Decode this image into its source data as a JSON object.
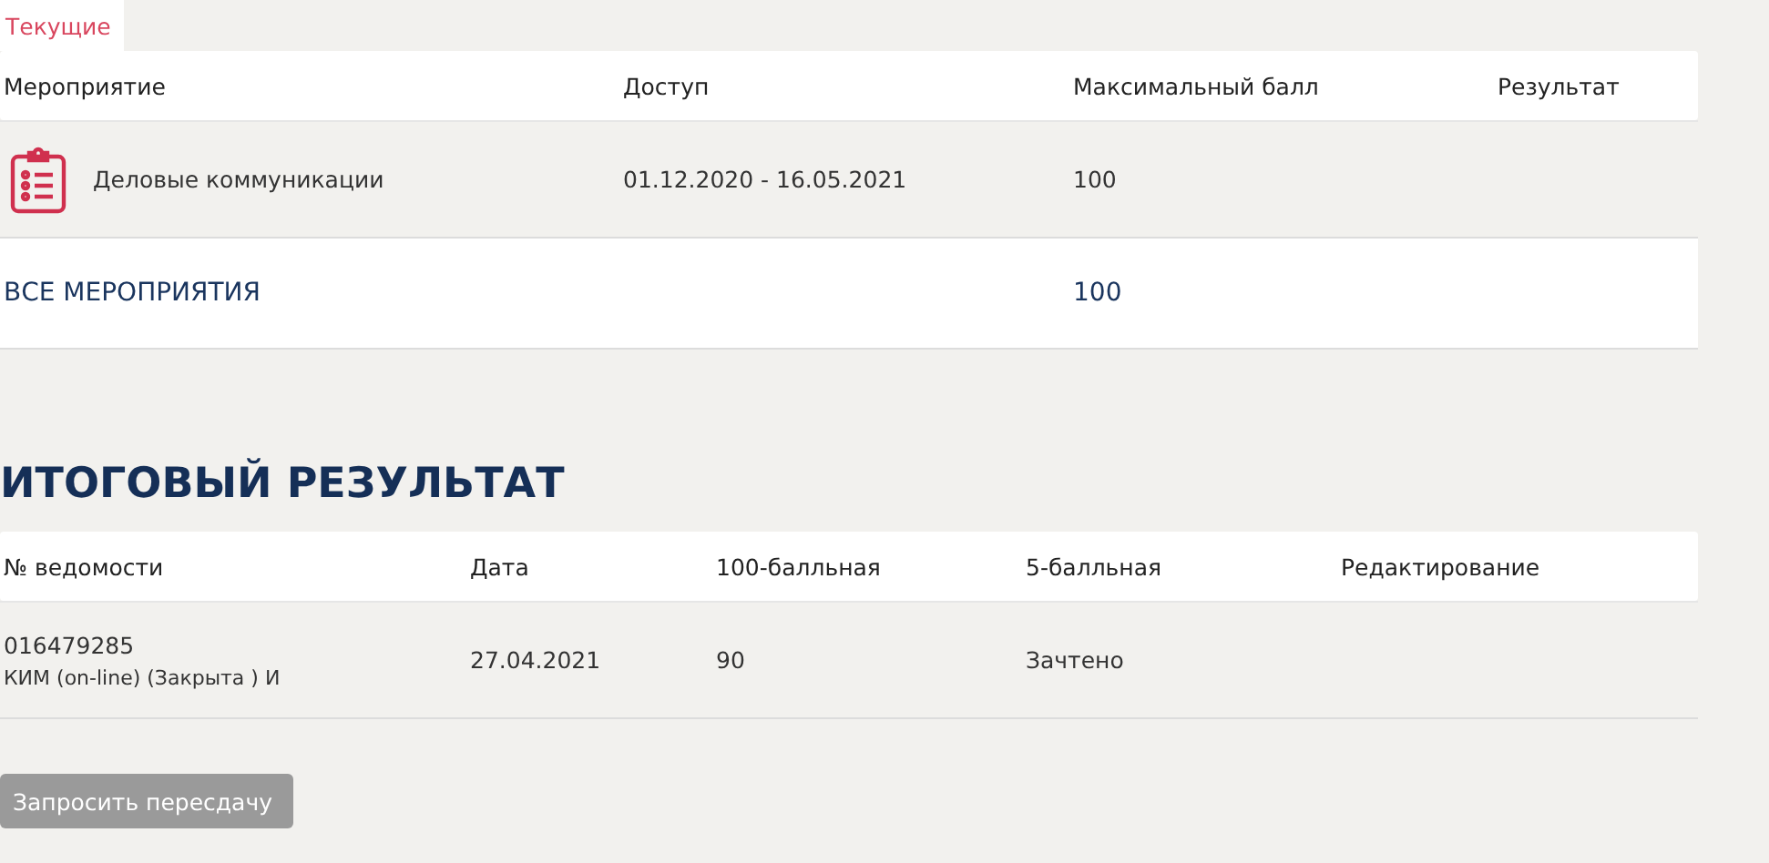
{
  "tabs": [
    {
      "label": "Текущие",
      "selected": true
    }
  ],
  "events_table": {
    "columns": [
      "Мероприятие",
      "Доступ",
      "Максимальный балл",
      "Результат"
    ],
    "rows": [
      {
        "name": "Деловые коммуникации",
        "access": "01.12.2020 - 16.05.2021",
        "max_score": "100"
      }
    ],
    "total": {
      "label": "ВСЕ МЕРОПРИЯТИЯ",
      "max_score": "100"
    }
  },
  "final_result": {
    "title": "ИТОГОВЫЙ РЕЗУЛЬТАТ",
    "columns": [
      "№ ведомости",
      "Дата",
      "100-балльная",
      "5-балльная",
      "Редактирование"
    ],
    "rows": [
      {
        "number": "016479285",
        "note": "КИМ (on-line) (Закрыта ) И",
        "date": "27.04.2021",
        "score_100": "90",
        "score_5": "Зачтено"
      }
    ]
  },
  "retake_button": {
    "label": "Запросить пересдачу",
    "disabled": true
  }
}
